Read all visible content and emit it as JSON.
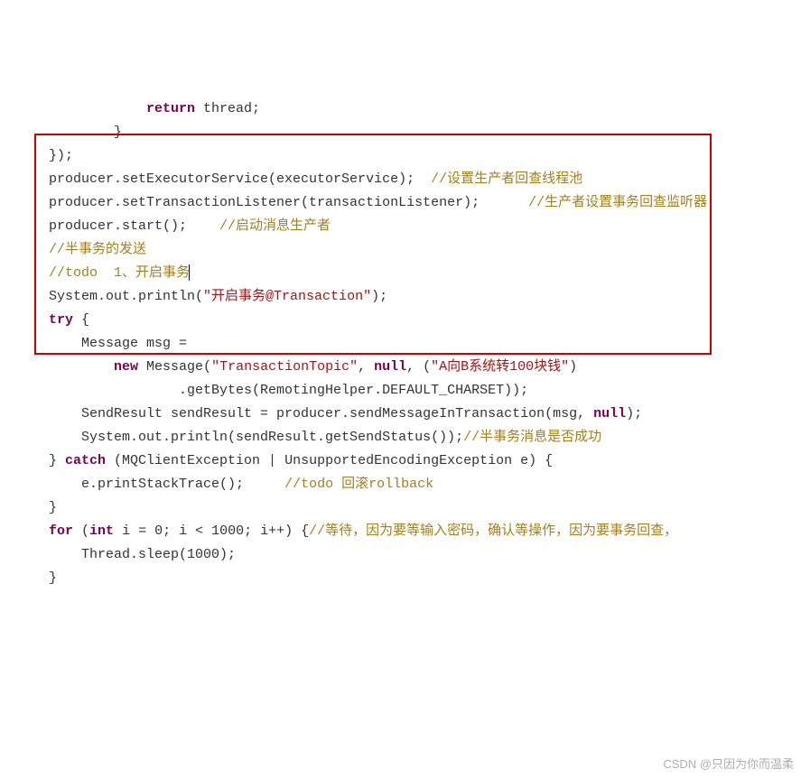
{
  "l01a": "return",
  "l01b": " thread;",
  "l02": "            }",
  "l03": "    });",
  "l04a": "    producer.setExecutorService(executorService);  ",
  "l04b": "//设置生产者回查线程池",
  "l05a": "    producer.setTransactionListener(transactionListener);      ",
  "l05b": "//生产者设置事务回查监听器",
  "l06a": "    producer.start();    ",
  "l06b": "//启动消息生产者",
  "l07": "    //半事务的发送",
  "l08": "    //todo  1、开启事务",
  "l09a": "    System.out.println(",
  "l09b": "\"开启事务@Transaction\"",
  "l09c": ");",
  "l10a": "    ",
  "l10b": "try",
  "l10c": " {",
  "l11": "        Message msg =",
  "l12a": "            ",
  "l12b": "new",
  "l12c": " Message(",
  "l12d": "\"TransactionTopic\"",
  "l12e": ", ",
  "l12f": "null",
  "l12g": ", (",
  "l12h": "\"A向B系统转100块钱\"",
  "l12i": ")",
  "l13": "                    .getBytes(RemotingHelper.DEFAULT_CHARSET));",
  "l14a": "        SendResult sendResult = producer.sendMessageInTransaction(msg, ",
  "l14b": "null",
  "l14c": ");",
  "l15a": "        System.out.println(sendResult.getSendStatus());",
  "l15b": "//半事务消息是否成功",
  "l16a": "    } ",
  "l16b": "catch",
  "l16c": " (MQClientException | UnsupportedEncodingException e) {",
  "l17a": "        e.printStackTrace();     ",
  "l17b": "//todo 回滚rollback",
  "l18": "    }",
  "l19a": "    ",
  "l19b": "for",
  "l19c": " (",
  "l19d": "int",
  "l19e": " i = ",
  "l19f": "0",
  "l19g": "; i < ",
  "l19h": "1000",
  "l19i": "; i++) {",
  "l19j": "//等待，因为要等输入密码，确认等操作，因为要事务回查，",
  "l20a": "        Thread.sleep(",
  "l20b": "1000",
  "l20c": ");",
  "l21": "    }",
  "watermark": "CSDN @只因为你而温柔"
}
